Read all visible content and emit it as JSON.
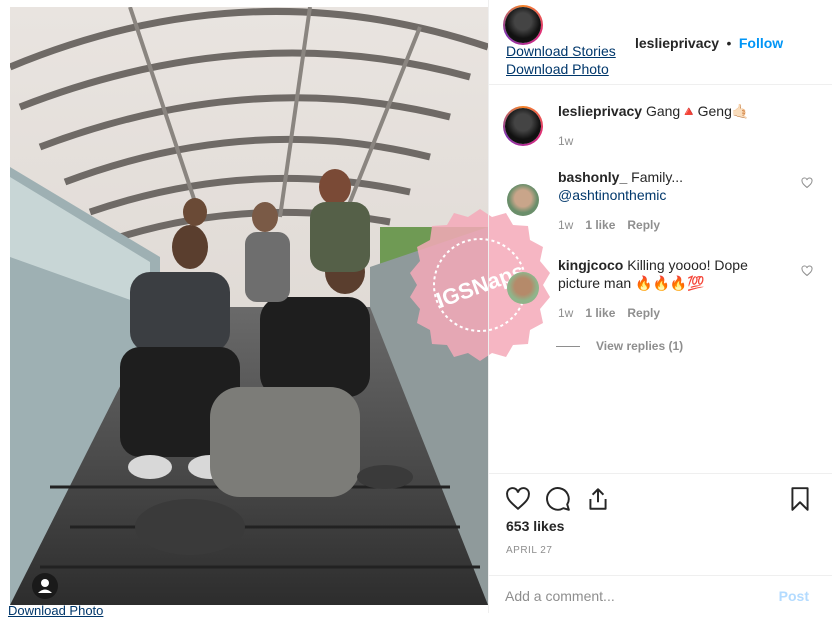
{
  "photo": {
    "below_link": "Download Photo",
    "tag_user_icon": "user-tag-icon"
  },
  "watermark": {
    "text": "IGSNaps",
    "color": "#f4a9b8"
  },
  "header": {
    "username": "leslieprivacy",
    "separator": "•",
    "follow_label": "Follow",
    "download_stories": "Download Stories",
    "download_photo": "Download Photo"
  },
  "caption": {
    "username": "leslieprivacy",
    "text": "Gang🔺Geng🤙🏻",
    "time": "1w"
  },
  "comments": [
    {
      "username": "bashonly_",
      "text": "Family...",
      "mention": "@ashtinonthemic",
      "time": "1w",
      "likes": "1 like",
      "reply": "Reply"
    },
    {
      "username": "kingjcoco",
      "text": "Killing yoooo! Dope picture man 🔥🔥🔥💯",
      "time": "1w",
      "likes": "1 like",
      "reply": "Reply"
    }
  ],
  "view_replies": "View replies (1)",
  "actions": {
    "likes": "653 likes",
    "date": "APRIL 27"
  },
  "add_comment": {
    "placeholder": "Add a comment...",
    "post_label": "Post"
  },
  "colors": {
    "link": "#00376b",
    "accent": "#0095f6",
    "muted": "#8e8e8e",
    "text": "#262626"
  }
}
